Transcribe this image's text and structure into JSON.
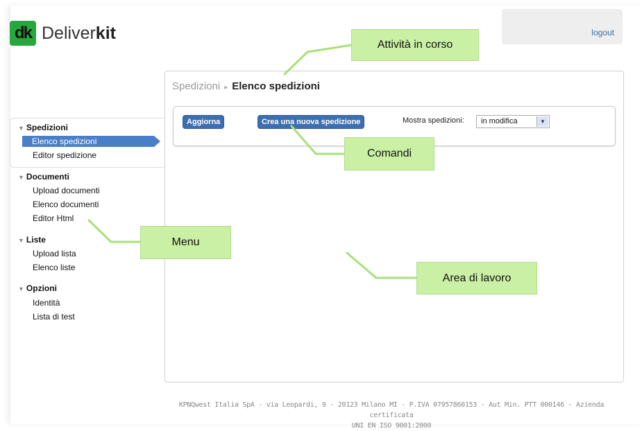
{
  "header": {
    "logo_mark": "dk",
    "brand_light": "Deliver",
    "brand_bold": "kit",
    "logout": "logout"
  },
  "breadcrumb": {
    "parent": "Spedizioni",
    "separator": "▸",
    "current": "Elenco spedizioni"
  },
  "commands": {
    "refresh": "Aggiorna",
    "new_shipment": "Crea una nuova spedizione",
    "show_label": "Mostra spedizioni:",
    "show_value": "in modifica"
  },
  "sidebar": {
    "sections": [
      {
        "title": "Spedizioni",
        "items": [
          "Elenco spedizioni",
          "Editor spedizione"
        ]
      },
      {
        "title": "Documenti",
        "items": [
          "Upload documenti",
          "Elenco documenti",
          "Editor Html"
        ]
      },
      {
        "title": "Liste",
        "items": [
          "Upload lista",
          "Elenco liste"
        ]
      },
      {
        "title": "Opzioni",
        "items": [
          "Identità",
          "Lista di test"
        ]
      }
    ]
  },
  "callouts": {
    "current_activity": "Attività in corso",
    "commands": "Comandi",
    "menu": "Menu",
    "work_area": "Area di lavoro"
  },
  "footer": {
    "line1": "KPNQwest Italia SpA - via Leopardi, 9 - 20123 Milano MI - P.IVA 07957860153 - Aut Min. PTT 000146 - Azienda certificata",
    "line2": "UNI EN ISO 9001:2000"
  },
  "colors": {
    "accent": "#4a7fc8",
    "button": "#3d6fb0",
    "callout": "#c9f0a4",
    "connector": "#a8e07a",
    "logo": "#27a83c"
  }
}
